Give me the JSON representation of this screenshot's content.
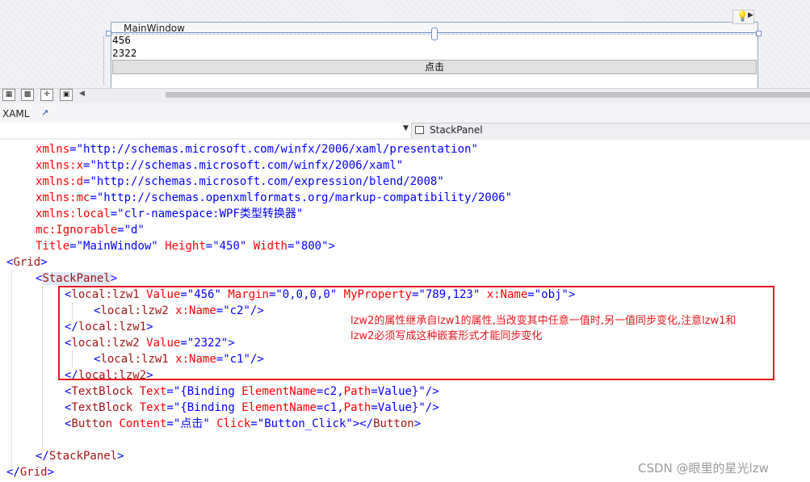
{
  "designer": {
    "window_title": "MainWindow",
    "textblock1": "456",
    "textblock2": "2322",
    "button_label": "点击",
    "lightbulb_icon": "lightbulb-icon"
  },
  "toolbar": {
    "icons": [
      "grid-icon",
      "snap-icon",
      "move-icon",
      "fit-icon"
    ]
  },
  "tabs": {
    "xaml": "XAML",
    "popout_icon": "popout-icon"
  },
  "element_selector": {
    "selected": "StackPanel"
  },
  "code": {
    "l1_attr": "xmlns",
    "l1_val": "\"http://schemas.microsoft.com/winfx/2006/xaml/presentation\"",
    "l2_attr": "xmlns:x",
    "l2_val": "\"http://schemas.microsoft.com/winfx/2006/xaml\"",
    "l3_attr": "xmlns:d",
    "l3_val": "\"http://schemas.microsoft.com/expression/blend/2008\"",
    "l4_attr": "xmlns:mc",
    "l4_val": "\"http://schemas.openxmlformats.org/markup-compatibility/2006\"",
    "l5_attr": "xmlns:local",
    "l5_val": "\"clr-namespace:WPF类型转换器\"",
    "l6_attr": "mc:Ignorable",
    "l6_val": "\"d\"",
    "l7_attr1": "Title",
    "l7_val1": "\"MainWindow\"",
    "l7_attr2": "Height",
    "l7_val2": "\"450\"",
    "l7_attr3": "Width",
    "l7_val3": "\"800\"",
    "l8_tag": "Grid",
    "l9_tag": "StackPanel",
    "l10_tag": "local:lzw1",
    "l10_attr1": "Value",
    "l10_val1": "\"456\"",
    "l10_attr2": "Margin",
    "l10_val2": "\"0,0,0,0\"",
    "l10_attr3": "MyProperty",
    "l10_val3": "\"789,123\"",
    "l10_attr4": "x:Name",
    "l10_val4": "\"obj\"",
    "l11_tag": "local:lzw2",
    "l11_attr": "x:Name",
    "l11_val": "\"c2\"",
    "l12_tag": "local:lzw1",
    "l13_tag": "local:lzw2",
    "l13_attr": "Value",
    "l13_val": "\"2322\"",
    "l14_tag": "local:lzw1",
    "l14_attr": "x:Name",
    "l14_val": "\"c1\"",
    "l15_tag": "local:lzw2",
    "l16_tag": "TextBlock",
    "l16_attr": "Text",
    "l16_q": "\"",
    "l16_b1": "{Binding",
    "l16_b2": "ElementName",
    "l16_b3": "=c2,",
    "l16_b4": "Path",
    "l16_b5": "=Value}\"",
    "l17_tag": "TextBlock",
    "l17_attr": "Text",
    "l17_q": "\"",
    "l17_b1": "{Binding",
    "l17_b2": "ElementName",
    "l17_b3": "=c1,",
    "l17_b4": "Path",
    "l17_b5": "=Value}\"",
    "l18_tag": "Button",
    "l18_attr1": "Content",
    "l18_val1": "\"点击\"",
    "l18_attr2": "Click",
    "l18_val2": "\"Button_Click\"",
    "l18_close": "Button",
    "l20_tag": "StackPanel",
    "l21_tag": "Grid"
  },
  "annotation": {
    "line1": "lzw2的属性继承自lzw1的属性,当改变其中任意一值时,另一值同步变化,注意lzw1和",
    "line2": "lzw2必须写成这种嵌套形式才能同步变化"
  },
  "watermark": "CSDN @眼里的星光lzw",
  "colors": {
    "annotation_red": "#e8161c",
    "xml_tag": "#a31515",
    "xml_attr": "#ff0000",
    "xml_value": "#0000ff"
  }
}
